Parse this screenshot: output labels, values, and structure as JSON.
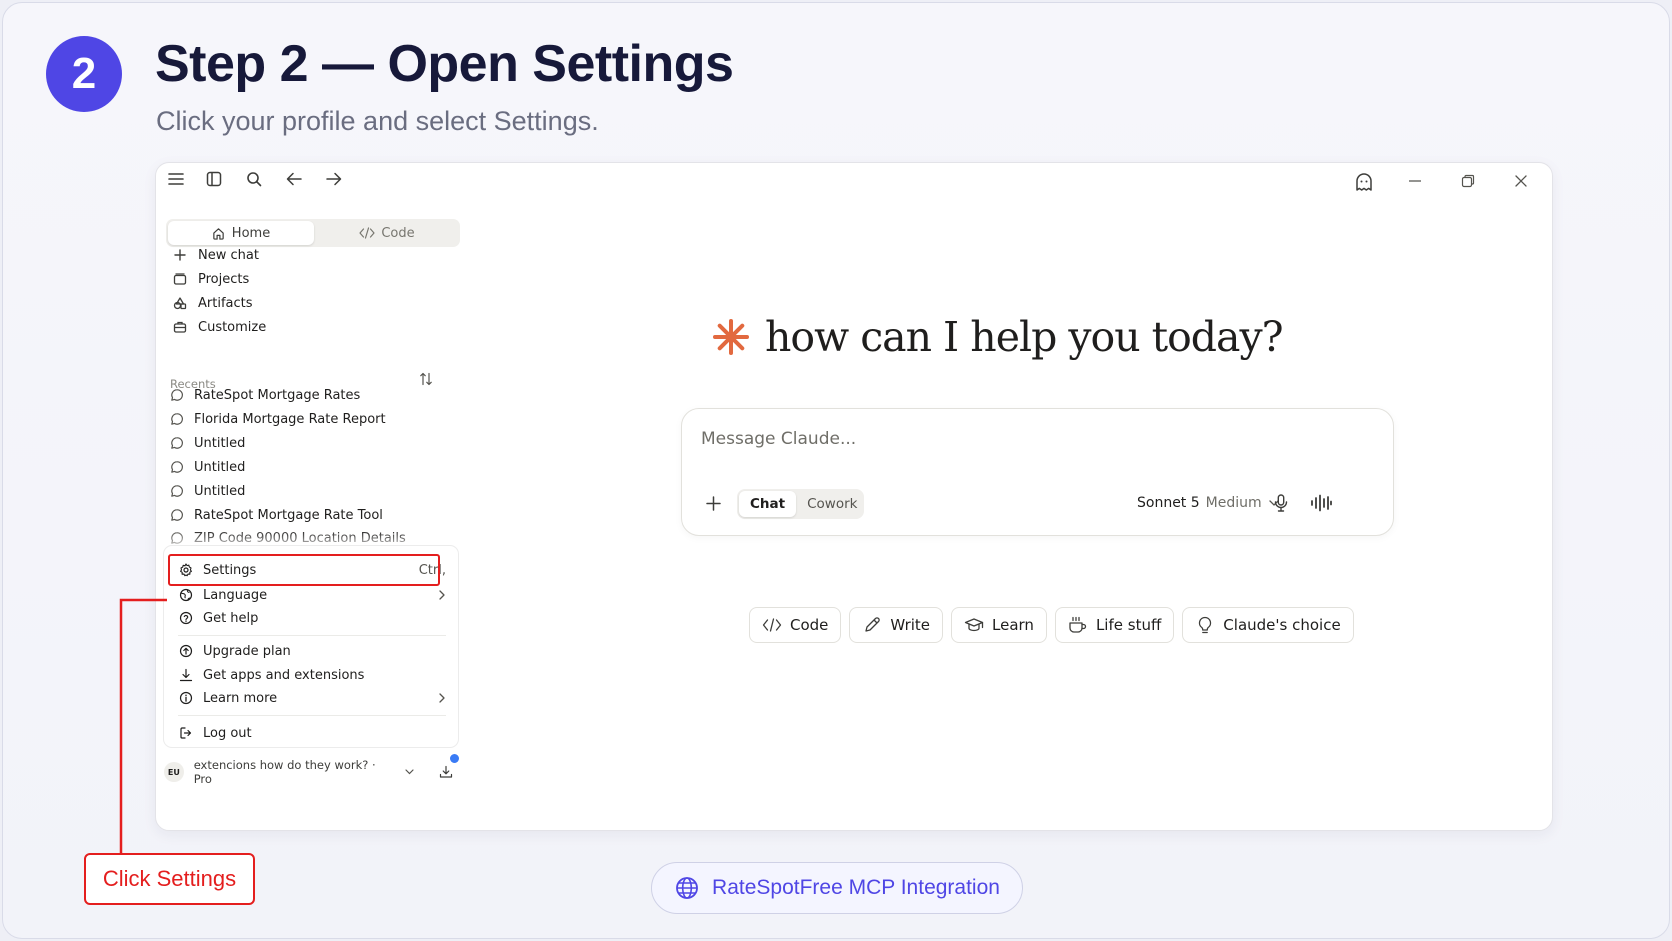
{
  "step": {
    "number": "2",
    "title": "Step 2 — Open Settings",
    "subtitle": "Click your profile and select Settings."
  },
  "sidebar": {
    "tabs": [
      {
        "label": "Home",
        "icon": "home-icon",
        "active": true
      },
      {
        "label": "Code",
        "icon": "code-icon",
        "active": false
      }
    ],
    "nav": [
      {
        "label": "New chat",
        "icon": "plus-icon"
      },
      {
        "label": "Projects",
        "icon": "folder-icon"
      },
      {
        "label": "Artifacts",
        "icon": "artifacts-icon"
      },
      {
        "label": "Customize",
        "icon": "briefcase-icon"
      }
    ],
    "recents_label": "Recents",
    "recents": [
      "RateSpot Mortgage Rates",
      "Florida Mortgage Rate Report",
      "Untitled",
      "Untitled",
      "Untitled",
      "RateSpot Mortgage Rate Tool",
      "ZIP Code 90000 Location Details"
    ]
  },
  "profile_menu": {
    "settings": {
      "label": "Settings",
      "shortcut": "Ctrl,"
    },
    "language": "Language",
    "get_help": "Get help",
    "upgrade_plan": "Upgrade plan",
    "get_apps": "Get apps and extensions",
    "learn_more": "Learn more",
    "log_out": "Log out"
  },
  "user": {
    "initials": "EU",
    "label": "extencions how do they work? · Pro"
  },
  "main": {
    "greeting": "how can I help you today?",
    "composer_placeholder": "Message Claude...",
    "modes": [
      "Chat",
      "Cowork"
    ],
    "model": "Sonnet 5",
    "effort": "Medium",
    "chips": [
      {
        "label": "Code",
        "icon": "code-icon"
      },
      {
        "label": "Write",
        "icon": "pencil-icon"
      },
      {
        "label": "Learn",
        "icon": "graduation-cap-icon"
      },
      {
        "label": "Life stuff",
        "icon": "coffee-cup-icon"
      },
      {
        "label": "Claude's choice",
        "icon": "lightbulb-icon"
      }
    ]
  },
  "callout": "Click Settings",
  "footer": "RateSpotFree MCP Integration",
  "colors": {
    "accent": "#4f46e5",
    "highlight": "#e41e1e",
    "claude_orange": "#e2693f"
  }
}
